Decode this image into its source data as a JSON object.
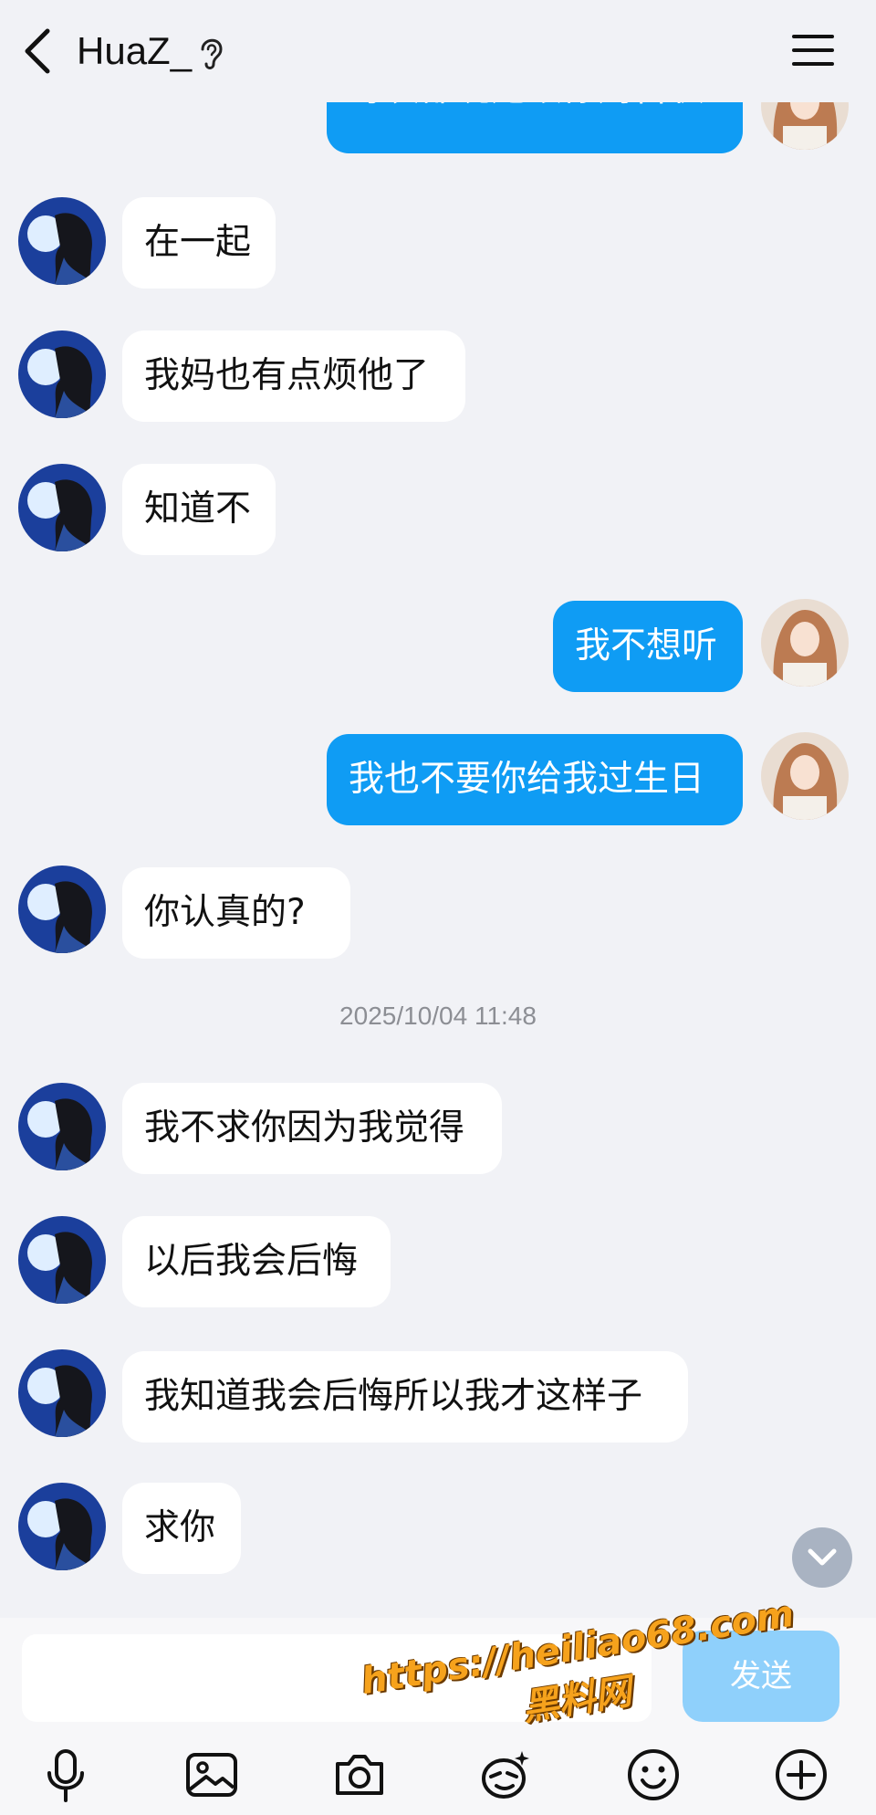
{
  "header": {
    "title": "HuaZ_",
    "back_icon": "chevron-left-icon",
    "status_icon": "ear-icon",
    "menu_icon": "hamburger-menu-icon"
  },
  "messages": [
    {
      "side": "out",
      "text": "每次都说她跟你妈告状"
    },
    {
      "side": "in",
      "text": "在一起"
    },
    {
      "side": "in",
      "text": "我妈也有点烦他了"
    },
    {
      "side": "in",
      "text": "知道不"
    },
    {
      "side": "out",
      "text": "我不想听"
    },
    {
      "side": "out",
      "text": "我也不要你给我过生日"
    },
    {
      "side": "in",
      "text": "你认真的?"
    },
    {
      "side": "in",
      "text": "我不求你因为我觉得"
    },
    {
      "side": "in",
      "text": "以后我会后悔"
    },
    {
      "side": "in",
      "text": "我知道我会后悔所以我才这样子"
    },
    {
      "side": "in",
      "text": "求你"
    }
  ],
  "timestamp": "2025/10/04 11:48",
  "composer": {
    "send_label": "发送",
    "tools": [
      "microphone-icon",
      "image-icon",
      "camera-icon",
      "sticker-icon",
      "emoji-icon",
      "plus-icon"
    ]
  },
  "watermark": {
    "url": "https://heiliao68.com",
    "name": "黑料网"
  },
  "colors": {
    "background": "#f1f2f6",
    "outgoing_bubble": "#0f9cf4",
    "incoming_bubble": "#ffffff",
    "send_button": "#8fd0fb",
    "watermark": "#f6a21c"
  }
}
